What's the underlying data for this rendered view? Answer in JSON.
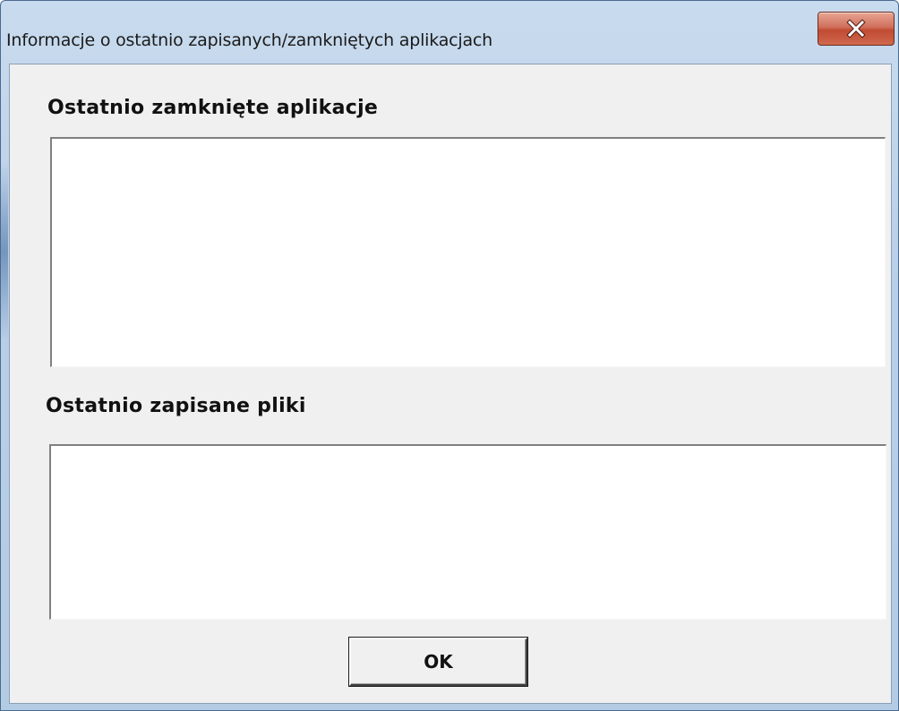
{
  "window": {
    "title": "Informacje o ostatnio zapisanych/zamkniętych aplikacjach",
    "close_icon": "close-icon"
  },
  "sections": {
    "closed_apps": {
      "label": "Ostatnio zamknięte aplikacje",
      "items": []
    },
    "saved_files": {
      "label": "Ostatnio zapisane pliki",
      "items": []
    }
  },
  "buttons": {
    "ok_label": "OK"
  },
  "colors": {
    "titlebar": "#b9cfe7",
    "close_button": "#c04a32",
    "client_background": "#f0f0f0",
    "listbox_background": "#ffffff"
  }
}
